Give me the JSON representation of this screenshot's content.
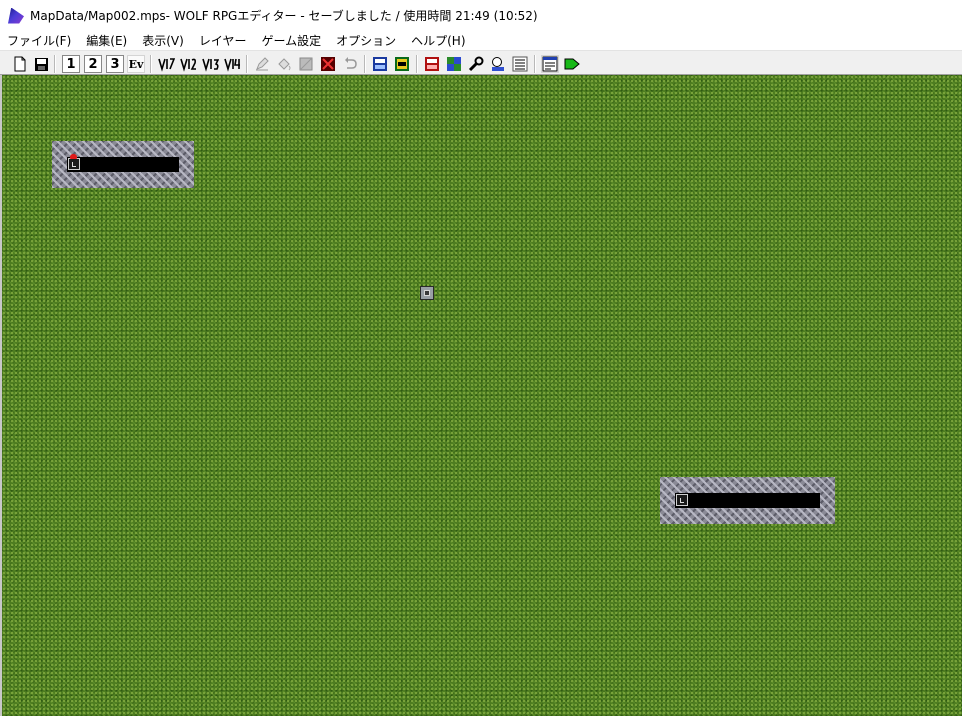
{
  "window": {
    "title": "MapData/Map002.mps- WOLF RPGエディター - セーブしました / 使用時間 21:49 (10:52)"
  },
  "menu": [
    {
      "label": "ファイル(F)"
    },
    {
      "label": "編集(E)"
    },
    {
      "label": "表示(V)"
    },
    {
      "label": "レイヤー"
    },
    {
      "label": "ゲーム設定"
    },
    {
      "label": "オプション"
    },
    {
      "label": "ヘルプ(H)"
    }
  ],
  "toolbar": {
    "layer1": "1",
    "layer2": "2",
    "layer3": "3",
    "event_layer": "Ev",
    "icons": [
      "new-file-icon",
      "save-icon",
      "pencil-icon",
      "fill-icon",
      "rect-icon",
      "erase-icon",
      "undo-icon",
      "user-db-icon",
      "sys-db-icon",
      "variable-db-icon",
      "tileset-icon",
      "tool-icon",
      "search-icon",
      "map-icon",
      "settings-icon",
      "play-icon"
    ]
  },
  "colors": {
    "grass": "#4e7d20",
    "stone": "#8a8a96",
    "accent_red": "#e01818"
  }
}
